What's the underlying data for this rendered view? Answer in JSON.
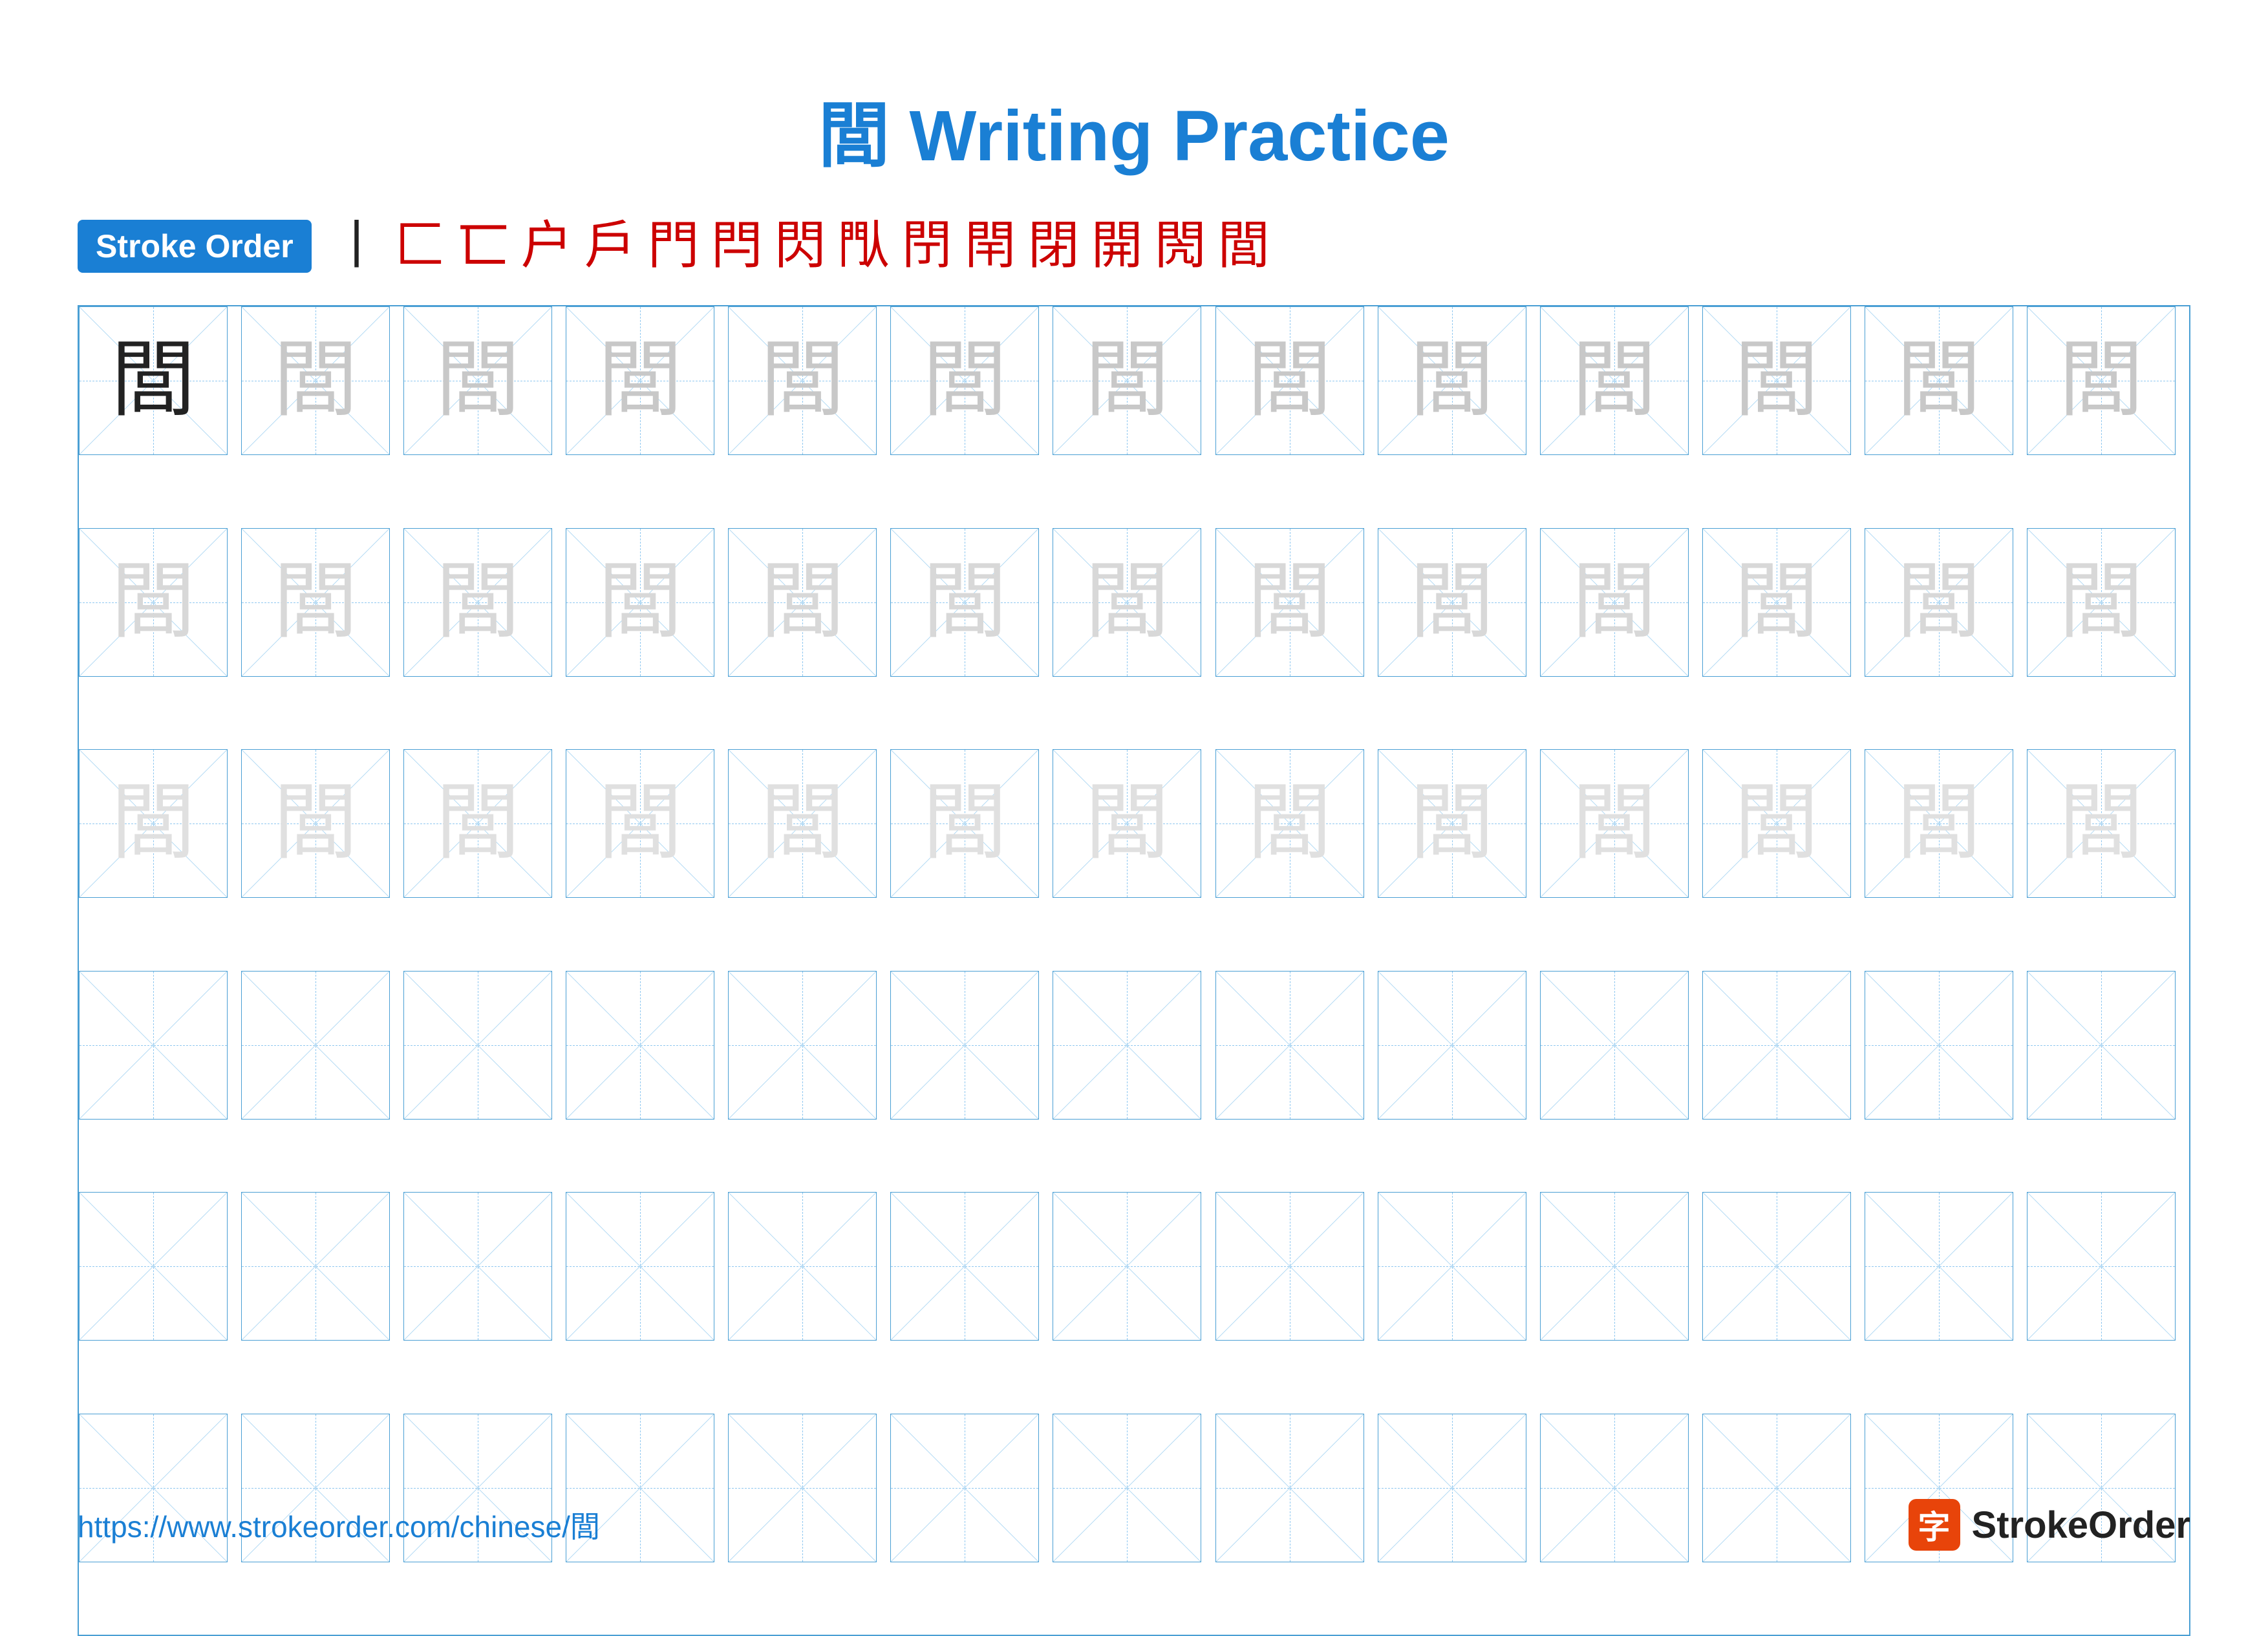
{
  "title": {
    "character": "閭",
    "text": "Writing Practice",
    "full": "閭 Writing Practice"
  },
  "stroke_order": {
    "badge_label": "Stroke Order",
    "strokes": [
      "丨",
      "⌐",
      "⌐̈",
      "户",
      "户·",
      "門",
      "閂",
      "閂",
      "閂",
      "閃",
      "閭̈",
      "閭",
      "閭",
      "閭",
      "閭"
    ]
  },
  "grid": {
    "rows": 6,
    "cols": 13,
    "character": "閭"
  },
  "footer": {
    "url": "https://www.strokeorder.com/chinese/閭",
    "logo_text": "StrokeOrder"
  },
  "colors": {
    "blue": "#1a7fd4",
    "red": "#cc0000",
    "dark": "#222222",
    "light_char": "#c8c8c8",
    "lighter_char": "#d8d8d8"
  }
}
